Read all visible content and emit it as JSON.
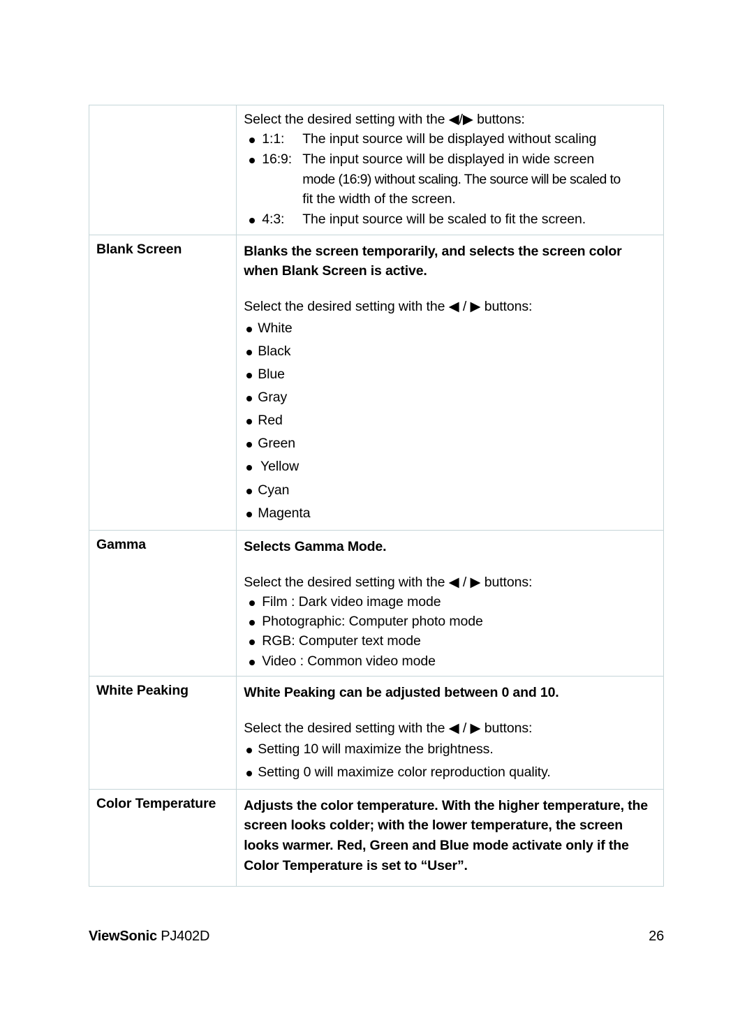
{
  "document": {
    "footer": {
      "brand": "ViewSonic",
      "model": "PJ402D",
      "page_number": "26"
    }
  },
  "table": {
    "rows": [
      {
        "id": "aspect-ratio",
        "label": "",
        "headline": "",
        "intro": "Select the desired setting with the ◀/▶ buttons:",
        "intro_arrows": "tight",
        "bullets": [
          {
            "key": "1:1:",
            "text": "The input source will be displayed without scaling"
          },
          {
            "key": "16:9:",
            "text": "The input source will be displayed in wide screen",
            "continuation": [
              "mode (16:9) without scaling. The source will be scaled to",
              "fit the width of the screen."
            ]
          },
          {
            "key": "4:3:",
            "text": "The input source will be scaled to fit the screen."
          }
        ]
      },
      {
        "id": "blank-screen",
        "label": "Blank Screen",
        "headline": "Blanks the screen temporarily, and selects the screen color when Blank Screen is active.",
        "intro": "Select the desired setting with the ◀ / ▶ buttons:",
        "intro_arrows": "loose",
        "bullets": [
          {
            "text": "White"
          },
          {
            "text": "Black"
          },
          {
            "text": "Blue"
          },
          {
            "text": "Gray"
          },
          {
            "text": "Red"
          },
          {
            "text": "Green"
          },
          {
            "text": " Yellow"
          },
          {
            "text": "Cyan"
          },
          {
            "text": "Magenta"
          }
        ]
      },
      {
        "id": "gamma",
        "label": "Gamma",
        "headline": "Selects Gamma Mode.",
        "intro": "Select the desired setting with the ◀ / ▶ buttons:",
        "intro_arrows": "loose",
        "bullets": [
          {
            "text": "Film : Dark video image mode"
          },
          {
            "text": "Photographic: Computer photo mode"
          },
          {
            "text": "RGB: Computer text mode"
          },
          {
            "text": "Video : Common video mode"
          }
        ]
      },
      {
        "id": "white-peaking",
        "label": "White Peaking",
        "headline": "White Peaking can be adjusted between 0 and 10.",
        "intro": "Select the desired setting with the ◀ / ▶ buttons:",
        "intro_arrows": "loose",
        "bullets": [
          {
            "text": "Setting 10 will maximize the brightness."
          },
          {
            "text": "Setting 0 will maximize color reproduction quality."
          }
        ]
      },
      {
        "id": "color-temperature",
        "label": "Color Temperature",
        "headline": "Adjusts the color temperature. With the higher temperature, the screen looks colder; with the lower temperature, the screen looks warmer. Red, Green and Blue mode activate only if the Color Temperature is set to “User”.",
        "intro": "",
        "bullets": []
      }
    ]
  },
  "colors": {
    "border": "#c5d5d8",
    "text": "#000000",
    "background": "#ffffff"
  }
}
